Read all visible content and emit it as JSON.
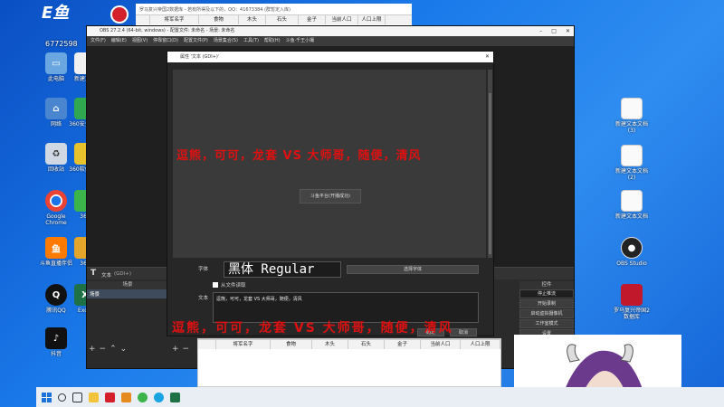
{
  "desktop": {
    "brand_counter": "6772598",
    "left_icons": [
      {
        "label": "此电脑",
        "icon": "computer-icon"
      },
      {
        "label": "新建文本",
        "icon": "text-file-icon"
      },
      {
        "label": "网络",
        "icon": "network-icon"
      },
      {
        "label": "360安全卫士",
        "icon": "security-icon"
      },
      {
        "label": "回收站",
        "icon": "recycle-bin-icon"
      },
      {
        "label": "360软件管家",
        "icon": "software-icon"
      },
      {
        "label": "Google Chrome",
        "icon": "chrome-icon"
      },
      {
        "label": "360",
        "icon": "browser-icon"
      },
      {
        "label": "斗鱼直播伴侣",
        "icon": "douyu-icon"
      },
      {
        "label": "360",
        "icon": "app-icon"
      },
      {
        "label": "腾讯QQ",
        "icon": "qq-icon"
      },
      {
        "label": "Excel",
        "icon": "excel-icon"
      },
      {
        "label": "抖音",
        "icon": "douyin-icon"
      }
    ],
    "right_icons": [
      {
        "label": "新建文本文档 (3)",
        "icon": "text-file-icon"
      },
      {
        "label": "新建文本文档 (2)",
        "icon": "text-file-icon"
      },
      {
        "label": "新建文本文档",
        "icon": "text-file-icon"
      },
      {
        "label": "OBS Studio",
        "icon": "obs-icon"
      },
      {
        "label": "罗马复兴帝国2数据库",
        "icon": "game-icon"
      }
    ]
  },
  "spreadsheet": {
    "title": "罗马复兴帝国2数据库 - 若有所得及以下的，QQ：41673384 (群暂定入库)",
    "columns": [
      "将军名字",
      "食物",
      "木头",
      "石头",
      "金子",
      "当前人口",
      "人口上限"
    ]
  },
  "obs": {
    "title": "OBS 27.2.4 (64-bit, windows) - 配置文件: 未命名 - 场景: 未命名",
    "menu": [
      "文件(F)",
      "编辑(E)",
      "视图(V)",
      "停靠窗口(D)",
      "配置文件(P)",
      "场景集合(S)",
      "工具(T)",
      "帮助(H)",
      "斗鱼·千王小撮"
    ],
    "source_toolbar": {
      "label": "文本",
      "hint": "(GDI+)"
    },
    "scenes_header": "场景",
    "sources_header": "来源",
    "scene_item": "场景",
    "controls_header": "控件",
    "controls": [
      "停止推流",
      "开始录制",
      "启动虚拟摄像机",
      "工作室模式",
      "设置",
      "退出"
    ]
  },
  "dialog": {
    "title": "属性 '文本 (GDI+)'",
    "preview_button": "斗鱼平台(开播成功)",
    "overlay_text": "逗熊，可可，龙套   VS   大师哥，随便，清风",
    "font_label": "字体",
    "font_name": "黑体 Regular",
    "font_button": "选择字体",
    "from_file_label": "从文件读取",
    "text_label": "文本",
    "text_value": "逗熊，可可，龙套    VS    大师哥，随便，清风",
    "ok_button": "确定",
    "cancel_button": "取消"
  },
  "bottom_overlay_text": "逗熊，可可，龙套   VS   大师哥，随便，清风",
  "taskbar_icons": [
    "search-icon",
    "taskview-icon",
    "folder-icon",
    "app-icon",
    "game-icon",
    "chrome-icon",
    "edge-icon",
    "app-icon"
  ]
}
